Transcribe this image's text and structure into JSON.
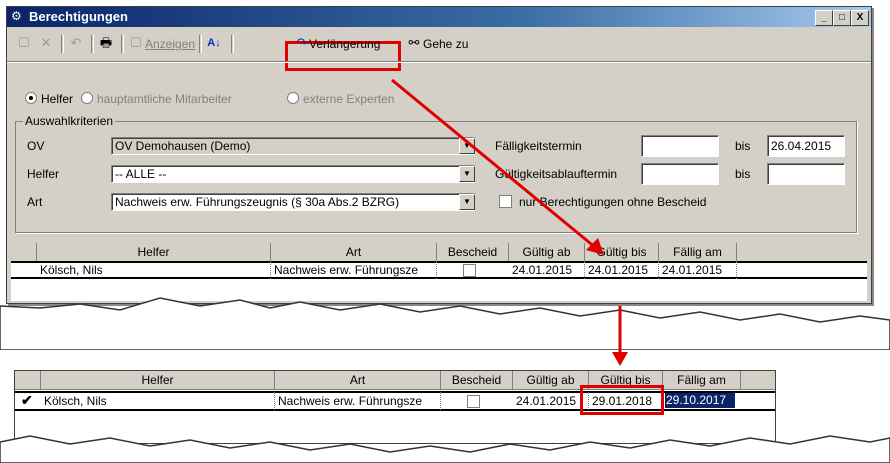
{
  "window": {
    "title": "Berechtigungen",
    "caption_buttons": [
      "_",
      "□",
      "X"
    ]
  },
  "toolbar": {
    "anzeigen_label": "Anzeigen",
    "verlaengerung_label": "Verlängerung",
    "gehe_zu_label": "Gehe zu"
  },
  "radios": [
    {
      "label": "Helfer",
      "selected": true
    },
    {
      "label": "hauptamtliche Mitarbeiter",
      "selected": false
    },
    {
      "label": "externe Experten",
      "selected": false
    }
  ],
  "criteria": {
    "group_label": "Auswahlkriterien",
    "ov_label": "OV",
    "ov_value": "OV Demohausen (Demo)",
    "helfer_label": "Helfer",
    "helfer_value": "-- ALLE --",
    "art_label": "Art",
    "art_value": "Nachweis erw. Führungszeugnis (§ 30a Abs.2 BZRG)",
    "faelligkeit_label": "Fälligkeitstermin",
    "faelligkeit_from": "",
    "bis_label": "bis",
    "faelligkeit_to": "26.04.2015",
    "gueltigkeit_label": "Gültigkeitsablauftermin",
    "gueltigkeit_from": "",
    "gueltigkeit_to": "",
    "ohne_bescheid_label": "nur Berechtigungen ohne Bescheid"
  },
  "grid": {
    "columns": [
      "Helfer",
      "Art",
      "Bescheid",
      "Gültig ab",
      "Gültig bis",
      "Fällig am"
    ],
    "rows_before": [
      {
        "helfer": "Kölsch, Nils",
        "art": "Nachweis erw. Führungsze",
        "gueltig_ab": "24.01.2015",
        "gueltig_bis": "24.01.2015",
        "faellig_am": "24.01.2015"
      }
    ],
    "rows_after": [
      {
        "helfer": "Kölsch, Nils",
        "art": "Nachweis erw. Führungsze",
        "gueltig_ab": "24.01.2015",
        "gueltig_bis": "29.01.2018",
        "faellig_am": "29.10.2017"
      }
    ]
  },
  "colors": {
    "highlight": "#e00000",
    "selection": "#0a246a",
    "title_bar": "#0a246a"
  }
}
